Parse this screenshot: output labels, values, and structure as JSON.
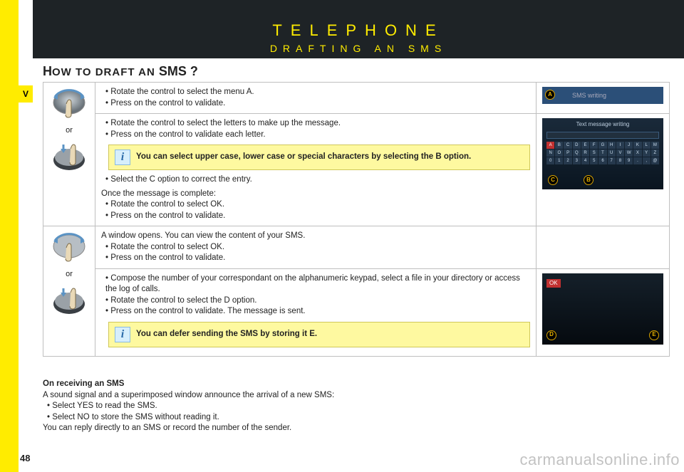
{
  "side_tab": "V",
  "header": {
    "title": "TELEPHONE",
    "subtitle": "DRAFTING AN SMS"
  },
  "heading": {
    "pre": "H",
    "rest": "OW TO DRAFT AN",
    "post": " SMS ?"
  },
  "or_label": "or",
  "row1": {
    "b1": "Rotate the control to select the menu A.",
    "b2": "Press on the control to validate.",
    "shot_label": "SMS writing",
    "marker": "A"
  },
  "row2": {
    "b1": "Rotate the control to select the letters to make up the message.",
    "b2": "Press on the control to validate each letter.",
    "info": "You can select upper case, lower case or special characters by selecting the B option.",
    "b3": "Select the C option to correct the entry.",
    "once": "Once the message is complete:",
    "b4": "Rotate the control to select OK.",
    "b5": "Press on the control to validate.",
    "kb_title": "Text message writing",
    "marker_c": "C",
    "marker_b": "B"
  },
  "row3": {
    "intro": "A window opens. You can view the content of your SMS.",
    "b1": "Rotate the control to select OK.",
    "b2": "Press on the control to validate."
  },
  "row4": {
    "b1": "Compose the number of your correspondant on the alphanumeric keypad, select a file in your directory or access the log of calls.",
    "b2": "Rotate the control to select the D option.",
    "b3": "Press on the control to validate. The message is sent.",
    "info": "You can defer sending the SMS by storing it E.",
    "ok": "OK",
    "marker_d": "D",
    "marker_e": "E"
  },
  "footer": {
    "head": "On receiving an SMS",
    "line1": "A sound signal and a superimposed window announce the arrival of a new SMS:",
    "b1": "Select YES to read the SMS.",
    "b2": "Select NO to store the SMS without reading it.",
    "line2": "You can reply directly to an SMS or record the number of the sender."
  },
  "page_number": "48",
  "watermark": "carmanualsonline.info"
}
